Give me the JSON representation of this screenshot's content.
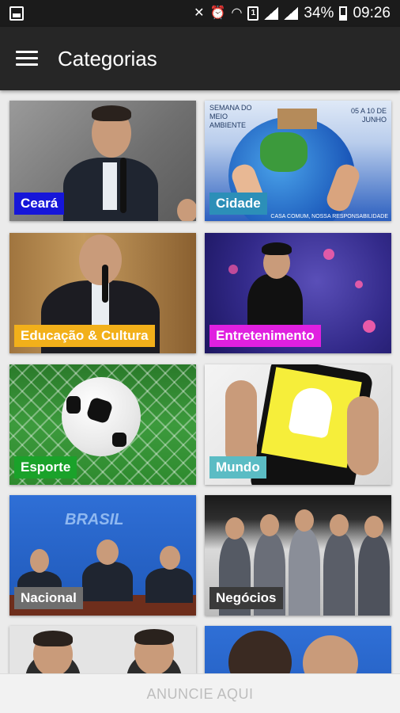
{
  "status_bar": {
    "battery": "34%",
    "time": "09:26",
    "sim": "1"
  },
  "app_bar": {
    "title": "Categorias",
    "menu_icon": "hamburger-menu-icon"
  },
  "categories": [
    {
      "label": "Ceará",
      "color": "#1616d9"
    },
    {
      "label": "Cidade",
      "color": "#2c8fb8"
    },
    {
      "label": "Educação & Cultura",
      "color": "#f2b01a"
    },
    {
      "label": "Entretenimento",
      "color": "#e020e0"
    },
    {
      "label": "Esporte",
      "color": "#1aa22a"
    },
    {
      "label": "Mundo",
      "color": "#5bbcc4"
    },
    {
      "label": "Nacional",
      "color": "#6e6e6e"
    },
    {
      "label": "Negócios",
      "color": "#3a3a3a"
    }
  ],
  "cidade_poster": {
    "left_text": "SEMANA DO MEIO AMBIENTE",
    "right_text": "05 A 10 DE JUNHO",
    "bottom_text": "CASA COMUM, NOSSA RESPONSABILIDADE"
  },
  "nacional_sign": "BRASIL",
  "ad_banner": "ANUNCIE AQUI"
}
